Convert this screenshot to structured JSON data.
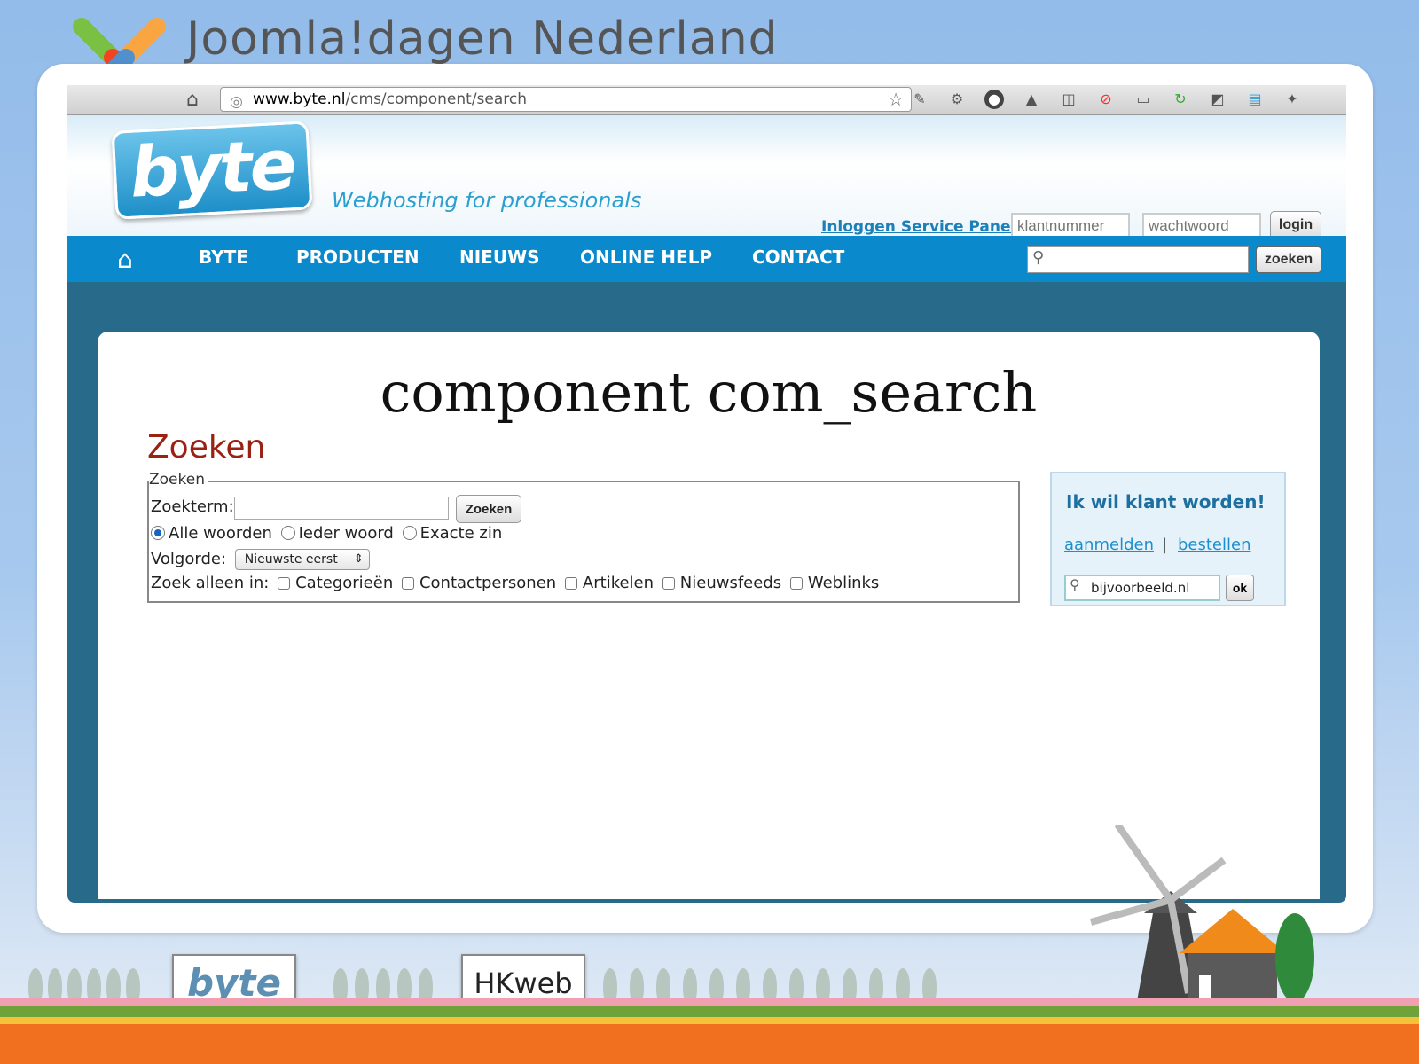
{
  "slide": {
    "deck_title": "Joomla!dagen Nederland",
    "heading": "component com_search"
  },
  "browser": {
    "url_host": "www.byte.nl",
    "url_path": "/cms/component/search"
  },
  "site": {
    "logo_text": "byte",
    "tagline": "Webhosting for professionals",
    "login_link": "Inloggen Service Panel",
    "customer_placeholder": "klantnummer",
    "password_placeholder": "wachtwoord",
    "login_button": "login",
    "nav": [
      "BYTE",
      "PRODUCTEN",
      "NIEUWS",
      "ONLINE HELP",
      "CONTACT"
    ],
    "search_button": "zoeken"
  },
  "search_page": {
    "title": "Zoeken",
    "legend": "Zoeken",
    "term_label": "Zoekterm:",
    "submit_label": "Zoeken",
    "match_options": [
      "Alle woorden",
      "Ieder woord",
      "Exacte zin"
    ],
    "match_selected": 0,
    "order_label": "Volgorde:",
    "order_value": "Nieuwste eerst",
    "areas_label": "Zoek alleen in:",
    "areas": [
      "Categorieën",
      "Contactpersonen",
      "Artikelen",
      "Nieuwsfeeds",
      "Weblinks"
    ]
  },
  "side_box": {
    "title": "Ik wil klant worden!",
    "link_signup": "aanmelden",
    "separator": "|",
    "link_order": "bestellen",
    "domain_value": "bijvoorbeeld.nl",
    "ok_button": "ok"
  },
  "billboards": {
    "left": "byte",
    "right": "HKweb"
  },
  "colors": {
    "nav_blue": "#0a8acc",
    "frame_blue": "#286a8a",
    "title_red": "#9a2214",
    "link_blue": "#1d8fcf"
  }
}
